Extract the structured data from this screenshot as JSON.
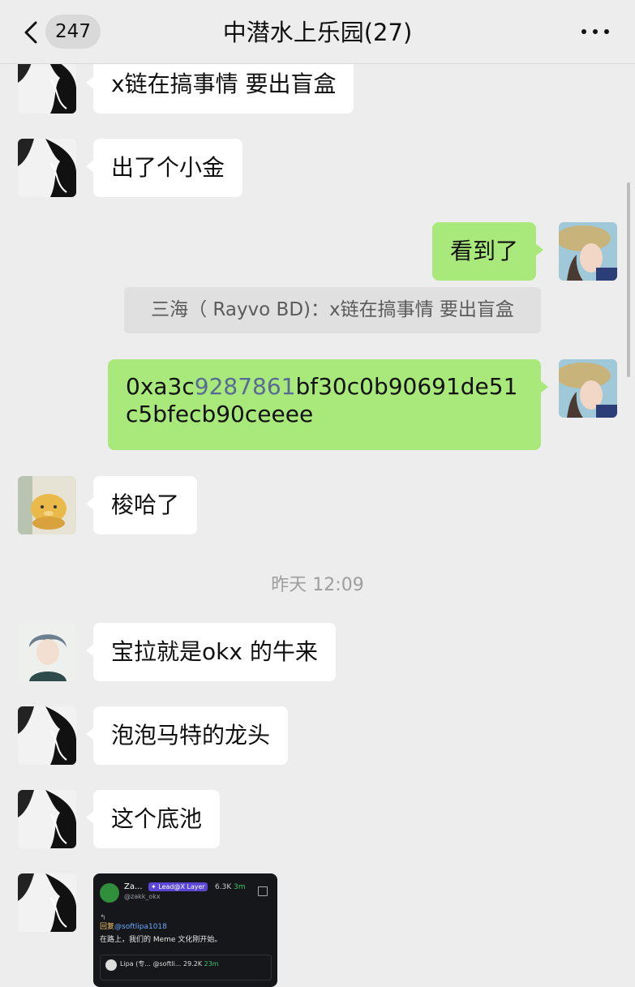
{
  "header": {
    "back_count": "247",
    "title": "中潜水上乐园(27)"
  },
  "messages": {
    "m1": "x链在搞事情 要出盲盒",
    "m2": "出了个小金",
    "m3": "看到了",
    "quote": "三海（ Rayvo  BD)：x链在搞事情 要出盲盒",
    "m4_pre": "0xa3c",
    "m4_link": "9287861",
    "m4_post": "bf30c0b90691de51c5bfecb90ceeee",
    "m5": "梭哈了",
    "timestamp": "昨天 12:09",
    "m6": "宝拉就是okx 的牛来",
    "m7": "泡泡马特的龙头",
    "m8": "这个底池"
  },
  "card": {
    "name": "Za...",
    "tag": "✦ Lead@X Layer",
    "handle": "@zakk_okx",
    "followers": "6.3K",
    "time": "3m",
    "reply_label": "回复",
    "reply_handle": "@softlipa1018",
    "text": "在路上，我们的 Meme 文化刚开始。",
    "sub_name": "Lipa",
    "sub_handle": "(专...  @softli...",
    "sub_followers": "29.2K",
    "sub_time": "23m"
  },
  "colors": {
    "background": "#ededed",
    "bubble_self": "#a9e97b",
    "bubble_other": "#ffffff",
    "link": "#576b95"
  }
}
